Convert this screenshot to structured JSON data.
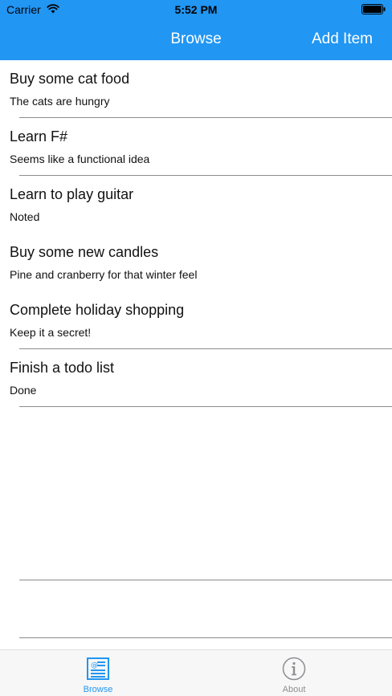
{
  "status_bar": {
    "carrier": "Carrier",
    "time": "5:52 PM"
  },
  "nav": {
    "title": "Browse",
    "action_label": "Add Item"
  },
  "items": [
    {
      "title": "Buy some cat food",
      "description": "The cats are hungry",
      "separator": true
    },
    {
      "title": "Learn F#",
      "description": "Seems like a functional idea",
      "separator": true
    },
    {
      "title": "Learn to play guitar",
      "description": "Noted",
      "separator": false
    },
    {
      "title": "Buy some new candles",
      "description": "Pine and cranberry for that winter feel",
      "separator": false
    },
    {
      "title": "Complete holiday shopping",
      "description": "Keep it a secret!",
      "separator": true
    },
    {
      "title": "Finish a todo list",
      "description": "Done",
      "separator": true
    }
  ],
  "tabs": [
    {
      "label": "Browse",
      "icon": "browse-list-icon",
      "selected": true
    },
    {
      "label": "About",
      "icon": "info-icon",
      "selected": false
    }
  ],
  "colors": {
    "accent": "#2196f3",
    "tab_inactive": "#8e8e93",
    "separator": "#8c8c8c"
  }
}
